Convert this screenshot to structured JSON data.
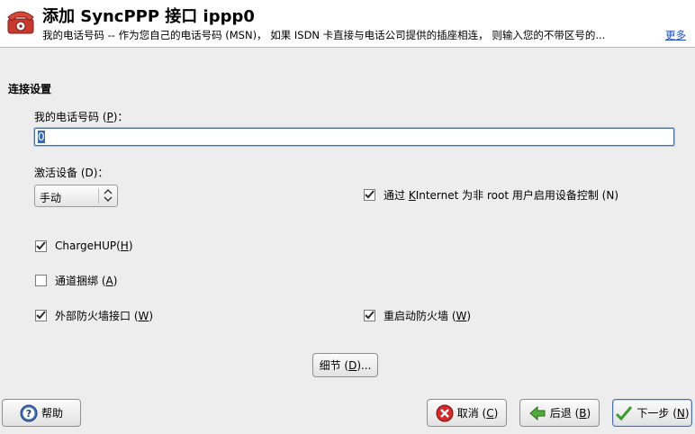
{
  "header": {
    "title": "添加  SyncPPP 接口  ippp0",
    "description": "我的电话号码 -- 作为您自己的电话号码 (MSN)， 如果 ISDN 卡直接与电话公司提供的插座相连， 则输入您的不带区号的...",
    "more_link": "更多",
    "icon": "telephone-icon"
  },
  "section": {
    "title": "连接设置"
  },
  "phone": {
    "label": "我的电话号码 (P)：",
    "label_pre": "我的电话号码 (",
    "label_key": "P",
    "label_post": ")：",
    "value": "0"
  },
  "activate": {
    "label": "激活设备 (D)：",
    "selected": "手动"
  },
  "checkboxes": {
    "kinternet": {
      "label": "通过 KInternet 为非 root 用户启用设备控制 (N)",
      "pre": "通过  ",
      "key": "K",
      "post": "Internet 为非  root 用户启用设备控制 (N)",
      "checked": true
    },
    "chargehup": {
      "pre": "ChargeHUP(",
      "key": "H",
      "post": ")",
      "checked": true
    },
    "bundling": {
      "pre": "通道捆绑 (",
      "key": "A",
      "post": ")",
      "checked": false
    },
    "ext_firewall": {
      "pre": "外部防火墙接口 (",
      "key": "W",
      "post": ")",
      "checked": true
    },
    "restart_firewall": {
      "pre": "重启动防火墙 (",
      "key": "W",
      "post": ")",
      "checked": true
    }
  },
  "buttons": {
    "details": {
      "pre": "细节 (",
      "key": "D",
      "post": ")..."
    },
    "help": "帮助",
    "cancel": {
      "pre": "取消 (",
      "key": "C",
      "post": ")"
    },
    "back": {
      "pre": "后退 (",
      "key": "B",
      "post": ")"
    },
    "next": {
      "pre": "下一步 (",
      "key": "N",
      "post": ")"
    }
  },
  "colors": {
    "accent": "#3d6aa8",
    "link": "#1d4fb2",
    "check": "#2a2a2a"
  }
}
